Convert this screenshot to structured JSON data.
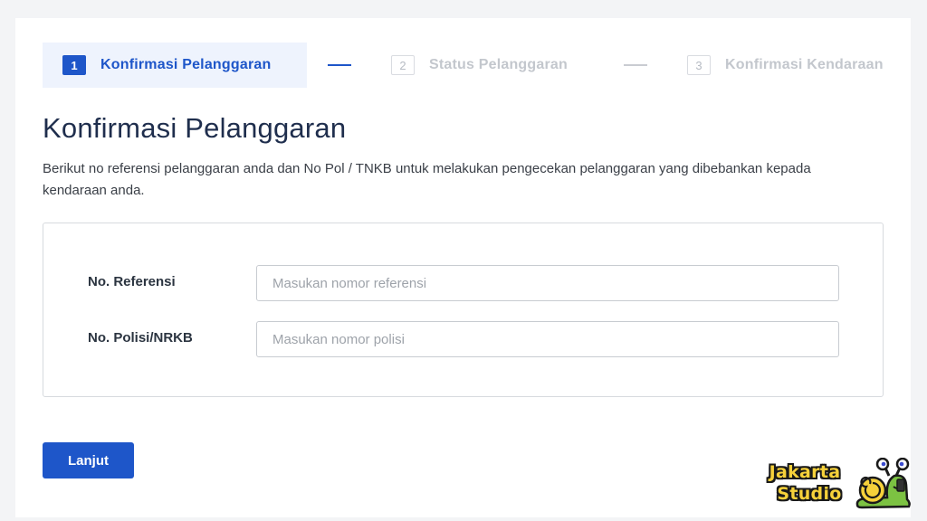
{
  "stepper": {
    "steps": [
      {
        "number": "1",
        "label": "Konfirmasi Pelanggaran",
        "state": "active"
      },
      {
        "number": "2",
        "label": "Status Pelanggaran",
        "state": "inactive"
      },
      {
        "number": "3",
        "label": "Konfirmasi Kendaraan",
        "state": "inactive"
      }
    ]
  },
  "page": {
    "title": "Konfirmasi Pelanggaran",
    "description": "Berikut no referensi pelanggaran anda dan No Pol / TNKB untuk melakukan pengecekan pelanggaran yang dibebankan kepada kendaraan anda."
  },
  "form": {
    "reference": {
      "label": "No. Referensi",
      "value": "",
      "placeholder": "Masukan nomor referensi"
    },
    "police_number": {
      "label": "No. Polisi/NRKB",
      "value": "",
      "placeholder": "Masukan nomor polisi"
    },
    "submit_label": "Lanjut"
  },
  "watermark": {
    "line1": "Jakarta",
    "line2": "Studio"
  },
  "colors": {
    "primary": "#1e56c9",
    "step_active_bg": "#eef3fd",
    "title": "#1f2e4d",
    "logo_yellow": "#f6d13a",
    "snail_green": "#7cc242"
  }
}
